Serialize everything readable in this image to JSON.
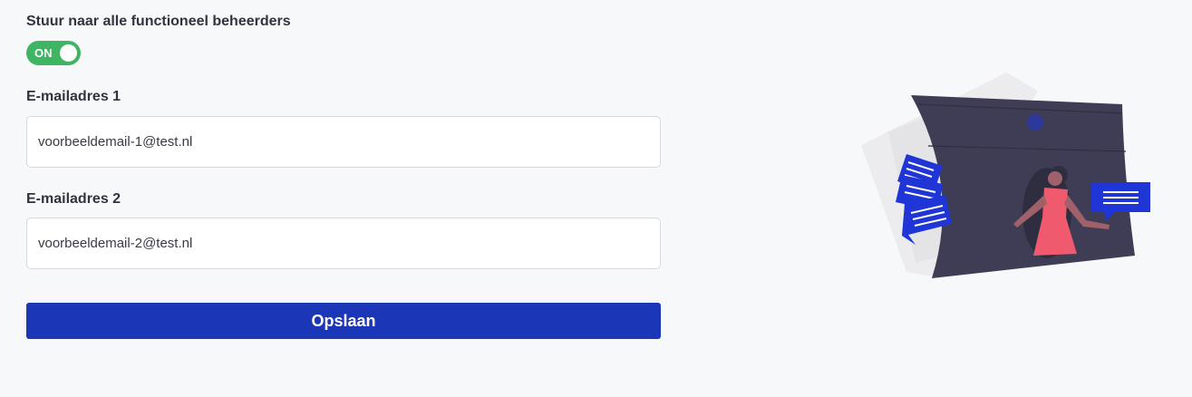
{
  "form": {
    "send_to_all_label": "Stuur naar alle functioneel beheerders",
    "toggle": {
      "state_label": "ON",
      "is_on": true,
      "color": "#3fb463"
    },
    "email1": {
      "label": "E-mailadres 1",
      "value": "voorbeeldemail-1@test.nl"
    },
    "email2": {
      "label": "E-mailadres 2",
      "value": "voorbeeldemail-2@test.nl"
    },
    "save_label": "Opslaan",
    "save_color": "#1b36b6"
  },
  "illustration": {
    "icon": "messages-illustration",
    "accent_color": "#1f35d6",
    "dark_color": "#3f3d56",
    "figure_color": "#ef5a6f"
  }
}
